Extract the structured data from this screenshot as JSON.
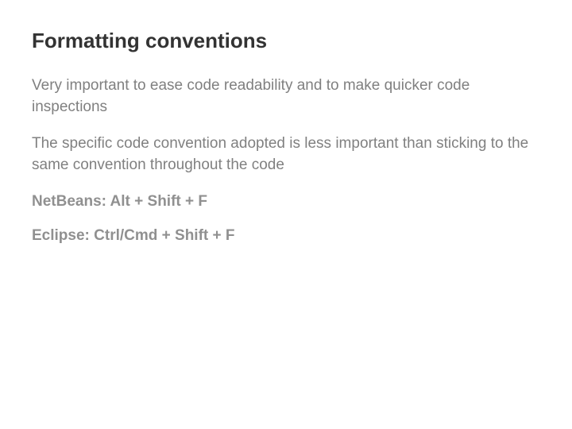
{
  "title": "Formatting conventions",
  "paragraphs": {
    "p1": "Very important to ease code readability and to make quicker code inspections",
    "p2": "The specific code convention adopted is less important than sticking to the same convention throughout the code",
    "p3": "NetBeans: Alt + Shift + F",
    "p4": "Eclipse: Ctrl/Cmd + Shift + F"
  }
}
